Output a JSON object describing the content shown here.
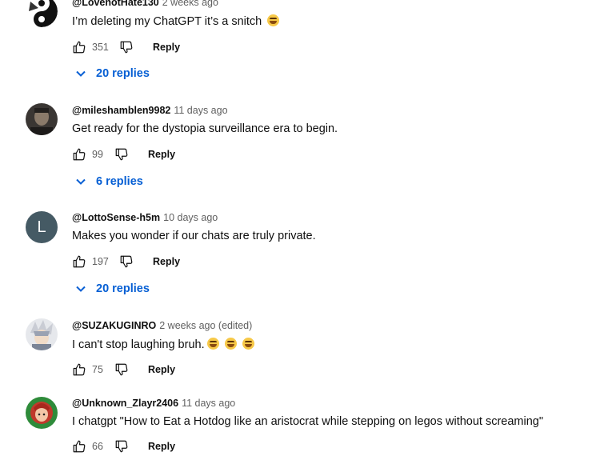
{
  "reply_label": "Reply",
  "comments": [
    {
      "author": "@LovenotHate130",
      "time": "2 weeks ago",
      "text": "I’m deleting my ChatGPT it’s a snitch",
      "emoji": [
        "laughing-emoji"
      ],
      "likes": "351",
      "replies": "20 replies",
      "avatar": {
        "type": "image",
        "description": "black-white-swirl",
        "colors": [
          "#111111",
          "#ffffff"
        ]
      }
    },
    {
      "author": "@mileshamblen9982",
      "time": "11 days ago",
      "text": "Get ready for the dystopia surveillance era to begin.",
      "likes": "99",
      "replies": "6 replies",
      "avatar": {
        "type": "image",
        "colors": [
          "#3a3633",
          "#8a7a6a"
        ]
      }
    },
    {
      "author": "@LottoSense-h5m",
      "time": "10 days ago",
      "text": "Makes you wonder if our chats are truly private.",
      "likes": "197",
      "replies": "20 replies",
      "avatar": {
        "type": "letter",
        "letter": "L",
        "bg": "#455a64",
        "fg": "#ffffff"
      }
    },
    {
      "author": "@SUZAKUGINRO",
      "time": "2 weeks ago (edited)",
      "text": "I can't stop laughing bruh.",
      "emoji": [
        "laughing-emoji",
        "laughing-emoji",
        "laughing-emoji"
      ],
      "likes": "75",
      "avatar": {
        "type": "image",
        "colors": [
          "#c9ccd4",
          "#7a8496"
        ]
      }
    },
    {
      "author": "@Unknown_Zlayr2406",
      "time": "11 days ago",
      "text": "I chatgpt \"How to Eat a Hotdog like an aristocrat while stepping on legos without screaming\"",
      "likes": "66",
      "avatar": {
        "type": "image",
        "colors": [
          "#2e8b3a",
          "#c0392b"
        ]
      }
    }
  ],
  "colors": {
    "link": "#065fd4",
    "secondary": "#606060",
    "primary": "#0f0f0f"
  }
}
